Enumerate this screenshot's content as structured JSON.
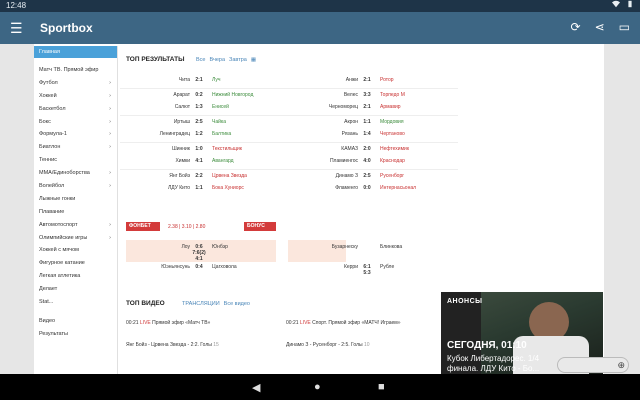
{
  "status": {
    "time": "12:48"
  },
  "app": {
    "title": "Sportbox",
    "menu_icon": "menu-icon",
    "actions": [
      "refresh-icon",
      "share-icon",
      "tv-icon"
    ]
  },
  "sidebar": {
    "active": "Главная",
    "items": [
      {
        "label": "Матч ТВ. Прямой эфир",
        "arrow": ""
      },
      {
        "label": "Футбол",
        "arrow": "›"
      },
      {
        "label": "Хоккей",
        "arrow": "›"
      },
      {
        "label": "Баскетбол",
        "arrow": "›"
      },
      {
        "label": "Бокс",
        "arrow": "›"
      },
      {
        "label": "Формула-1",
        "arrow": "›"
      },
      {
        "label": "Биатлон",
        "arrow": "›"
      },
      {
        "label": "Теннис",
        "arrow": ""
      },
      {
        "label": "ММА/Единоборства",
        "arrow": "›"
      },
      {
        "label": "Волейбол",
        "arrow": "›"
      },
      {
        "label": "Лыжные гонки",
        "arrow": ""
      },
      {
        "label": "Плавание",
        "arrow": ""
      },
      {
        "label": "Автомотоспорт",
        "arrow": "›"
      },
      {
        "label": "Олимпийские игры",
        "arrow": "›"
      },
      {
        "label": "Хоккей с мячом",
        "arrow": ""
      },
      {
        "label": "Фигурное катание",
        "arrow": ""
      },
      {
        "label": "Легкая атлетика",
        "arrow": ""
      },
      {
        "label": "Делает",
        "arrow": ""
      },
      {
        "label": "Stat...",
        "arrow": ""
      }
    ],
    "bottom": [
      "Видео",
      "Результаты"
    ]
  },
  "top_results": {
    "title": "ТОП РЕЗУЛЬТАТЫ",
    "links": [
      "Все",
      "Вчера",
      "Завтра"
    ],
    "left": [
      {
        "home": "Чита",
        "score": "2:1",
        "away": "Луч"
      },
      {
        "home": "Арарат",
        "score": "0:2",
        "away": "Нижний Новгород"
      },
      {
        "home": "Салют",
        "score": "1:3",
        "away": "Енисей"
      },
      {
        "home": "Иртыш",
        "score": "2:5",
        "away": "Чайка"
      },
      {
        "home": "Ленинградец",
        "score": "1:2",
        "away": "Балтика"
      },
      {
        "home": "Шинник",
        "score": "1:0",
        "away": "Текстильщик"
      },
      {
        "home": "Химки",
        "score": "4:1",
        "away": "Авангард"
      },
      {
        "home": "Янг Бойз",
        "score": "2:2",
        "away": "Црвена Звезда"
      },
      {
        "home": "ЛДУ Кито",
        "score": "1:1",
        "away": "Бока Хуниорс"
      }
    ],
    "right": [
      {
        "home": "Анжи",
        "score": "2:1",
        "away": "Ротор"
      },
      {
        "home": "Велес",
        "score": "3:3",
        "away": "Торпедо М"
      },
      {
        "home": "Черноморец",
        "score": "2:1",
        "away": "Армавир"
      },
      {
        "home": "Акрон",
        "score": "1:1",
        "away": "Мордовия"
      },
      {
        "home": "Рязань",
        "score": "1:4",
        "away": "Чертаново"
      },
      {
        "home": "КАМАЗ",
        "score": "2:0",
        "away": "Нефтехимик"
      },
      {
        "home": "Пламиенгос",
        "score": "4:0",
        "away": "Краснодар"
      },
      {
        "home": "Динамо З",
        "score": "2:5",
        "away": "Русенборг"
      },
      {
        "home": "Фламенго",
        "score": "0:0",
        "away": "Интернасьонал"
      }
    ],
    "bookmakers": [
      "ФОНБЕТ",
      "БОНУС"
    ],
    "odds": "2.38 | 3.10 | 2.80",
    "extra_left": [
      {
        "home": "Лоу",
        "score": "0:6 7:6(2) 4:1",
        "away": "Юнбэр"
      },
      {
        "home": "Юэньянсунь",
        "score": "0:4",
        "away": "Цагховола"
      }
    ],
    "extra_right": [
      {
        "home": "Бузарнеску",
        "score": "",
        "away": "Блинкова"
      },
      {
        "home": "Керри",
        "score": "6:1 5:3",
        "away": "Рубле"
      }
    ]
  },
  "top_video": {
    "title": "ТОП ВИДЕО",
    "links": [
      "ТРАНСЛЯЦИИ",
      "Все видео"
    ],
    "items": [
      {
        "time": "00:21",
        "live": "LIVE",
        "text": "Прямой эфир «Матч ТВ»",
        "count": ""
      },
      {
        "time": "00:21",
        "live": "LIVE",
        "text": "Спорт. Прямой эфир «МАТЧ! Играем»",
        "count": ""
      },
      {
        "time": "",
        "live": "",
        "text": "Янг Бойз - Црвена Звезда - 2:2. Голы",
        "count": "15"
      },
      {
        "time": "",
        "live": "",
        "text": "Динамо З - Русенборг - 2:5. Голы",
        "count": "10"
      }
    ]
  },
  "announce": {
    "label": "АНОНСЫ",
    "headline": "СЕГОДНЯ, 01:10",
    "line1": "Кубок Либертадорес. 1/4",
    "line2": "финала. ЛДУ Кито - Бо..."
  },
  "colors": {
    "appbar": "#3d6684",
    "accent": "#4aa1d9",
    "win": "#3c8c3c",
    "loss": "#c83030",
    "banner_red": "#d33b3b"
  }
}
